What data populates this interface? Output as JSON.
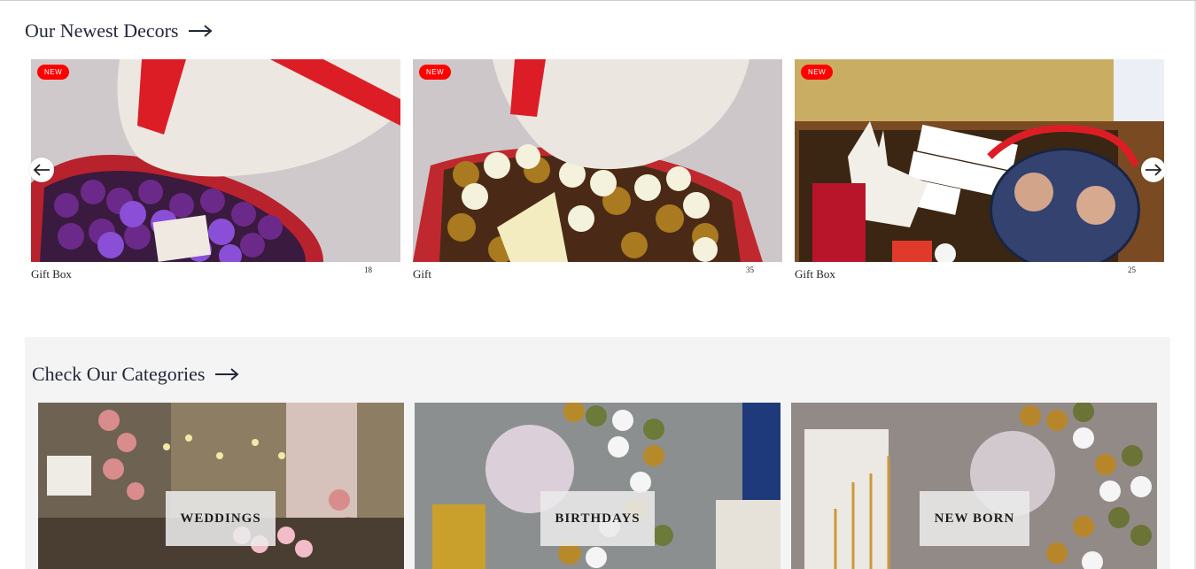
{
  "newest": {
    "title": "Our Newest Decors",
    "items": [
      {
        "badge": "NEW",
        "name": "Gift Box",
        "count": "18",
        "image": "purple-roses-heart-box"
      },
      {
        "badge": "NEW",
        "name": "Gift",
        "count": "35",
        "image": "gold-white-roses-heart-box"
      },
      {
        "badge": "NEW",
        "name": "Gift Box",
        "count": "25",
        "image": "kinder-photo-gift-box"
      }
    ]
  },
  "categories": {
    "title": "Check Our Categories",
    "items": [
      {
        "label": "WEDDINGS",
        "image": "wedding-table-decor"
      },
      {
        "label": "BIRTHDAYS",
        "image": "birthday-balloon-arch"
      },
      {
        "label": "NEW BORN",
        "image": "newborn-balloon-arch"
      }
    ]
  },
  "colors": {
    "badge": "#ff0000",
    "title": "#23283a",
    "section_bg": "#f4f4f4"
  }
}
